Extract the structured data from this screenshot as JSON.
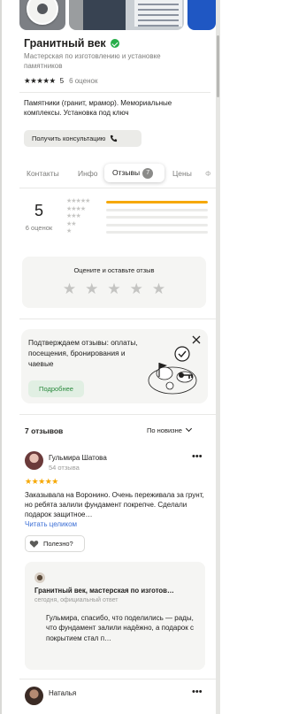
{
  "organization": {
    "name": "Гранитный век",
    "subtitle": "Мастерская по изготовлению и установке памятников",
    "rating_stars": "★★★★★",
    "rating_value": "5",
    "rating_count": "6 оценок",
    "description": "Памятники (гранит, мрамор). Мемориальные комплексы. Установка под ключ",
    "consult_label": "Получить консультацию"
  },
  "tabs": {
    "contacts": "Контакты",
    "info": "Инфо",
    "reviews": "Отзывы",
    "reviews_count": "7",
    "prices": "Цены",
    "more": "Ф"
  },
  "summary": {
    "rating": "5",
    "count": "6 оценок",
    "distribution": [
      {
        "stars": "★★★★★",
        "fraction": 1.0
      },
      {
        "stars": "★★★★",
        "fraction": 0.0
      },
      {
        "stars": "★★★",
        "fraction": 0.0
      },
      {
        "stars": "★★",
        "fraction": 0.0
      },
      {
        "stars": "★",
        "fraction": 0.0
      }
    ],
    "rate_prompt": "Оцените и оставьте отзыв",
    "empty_stars": [
      "★",
      "★",
      "★",
      "★",
      "★"
    ]
  },
  "promo": {
    "text": "Подтверждаем отзывы: оплаты, посещения, бронирования и чаевые",
    "button": "Подробнее"
  },
  "reviews": {
    "heading": "7 отзывов",
    "sort_label": "По новизне",
    "items": [
      {
        "name": "Гульмира Шатова",
        "meta": "54 отзыва",
        "stars": "★★★★★",
        "text": "Заказывала на Воронино. Очень переживала за грунт, но ребята залили фундамент покрепче. Сделали подарок защитное…",
        "read_more": "Читать целиком",
        "useful": "Полезно?",
        "answer": {
          "name": "Гранитный век, мастерская по изготов…",
          "meta": "сегодня, официальный ответ",
          "text": "Гульмира, спасибо, что поделились — рады, что фундамент залили надёжно, а подарок с покрытием стал п…"
        }
      },
      {
        "name": "Наталья"
      }
    ]
  },
  "colors": {
    "accent_star": "#f6a804",
    "verified": "#27ae4a",
    "link": "#3c6fd6",
    "promo_button_text": "#2b8a3e"
  },
  "icons": [
    "verified-icon",
    "phone-icon",
    "close-icon",
    "thumb-up-icon",
    "more-icon",
    "chevron-down-icon"
  ]
}
